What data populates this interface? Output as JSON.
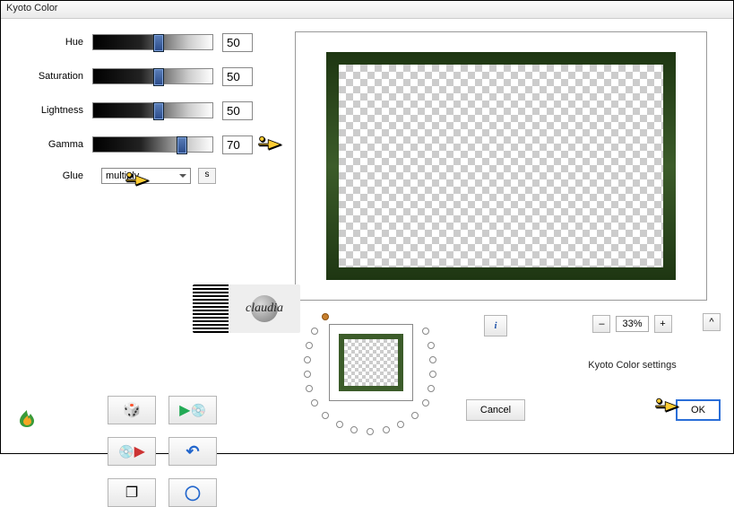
{
  "window": {
    "title": "Kyoto Color"
  },
  "sliders": {
    "hue": {
      "label": "Hue",
      "value": "50",
      "pos": 50
    },
    "saturation": {
      "label": "Saturation",
      "value": "50",
      "pos": 50
    },
    "lightness": {
      "label": "Lightness",
      "value": "50",
      "pos": 50
    },
    "gamma": {
      "label": "Gamma",
      "value": "70",
      "pos": 70
    }
  },
  "glue": {
    "label": "Glue",
    "value": "multiply",
    "swap": "s"
  },
  "signature": "claudia",
  "icons": {
    "dice": "🎲",
    "play": "▶",
    "disc": "💿",
    "disc2": "💿",
    "play2": "▶",
    "undo": "↶",
    "copy": "❐",
    "ring": "◯"
  },
  "info_label": "i",
  "zoom": {
    "minus": "–",
    "plus": "+",
    "value": "33%"
  },
  "caret": "^",
  "settings_label": "Kyoto Color settings",
  "buttons": {
    "cancel": "Cancel",
    "ok": "OK"
  },
  "fire": "🔥"
}
